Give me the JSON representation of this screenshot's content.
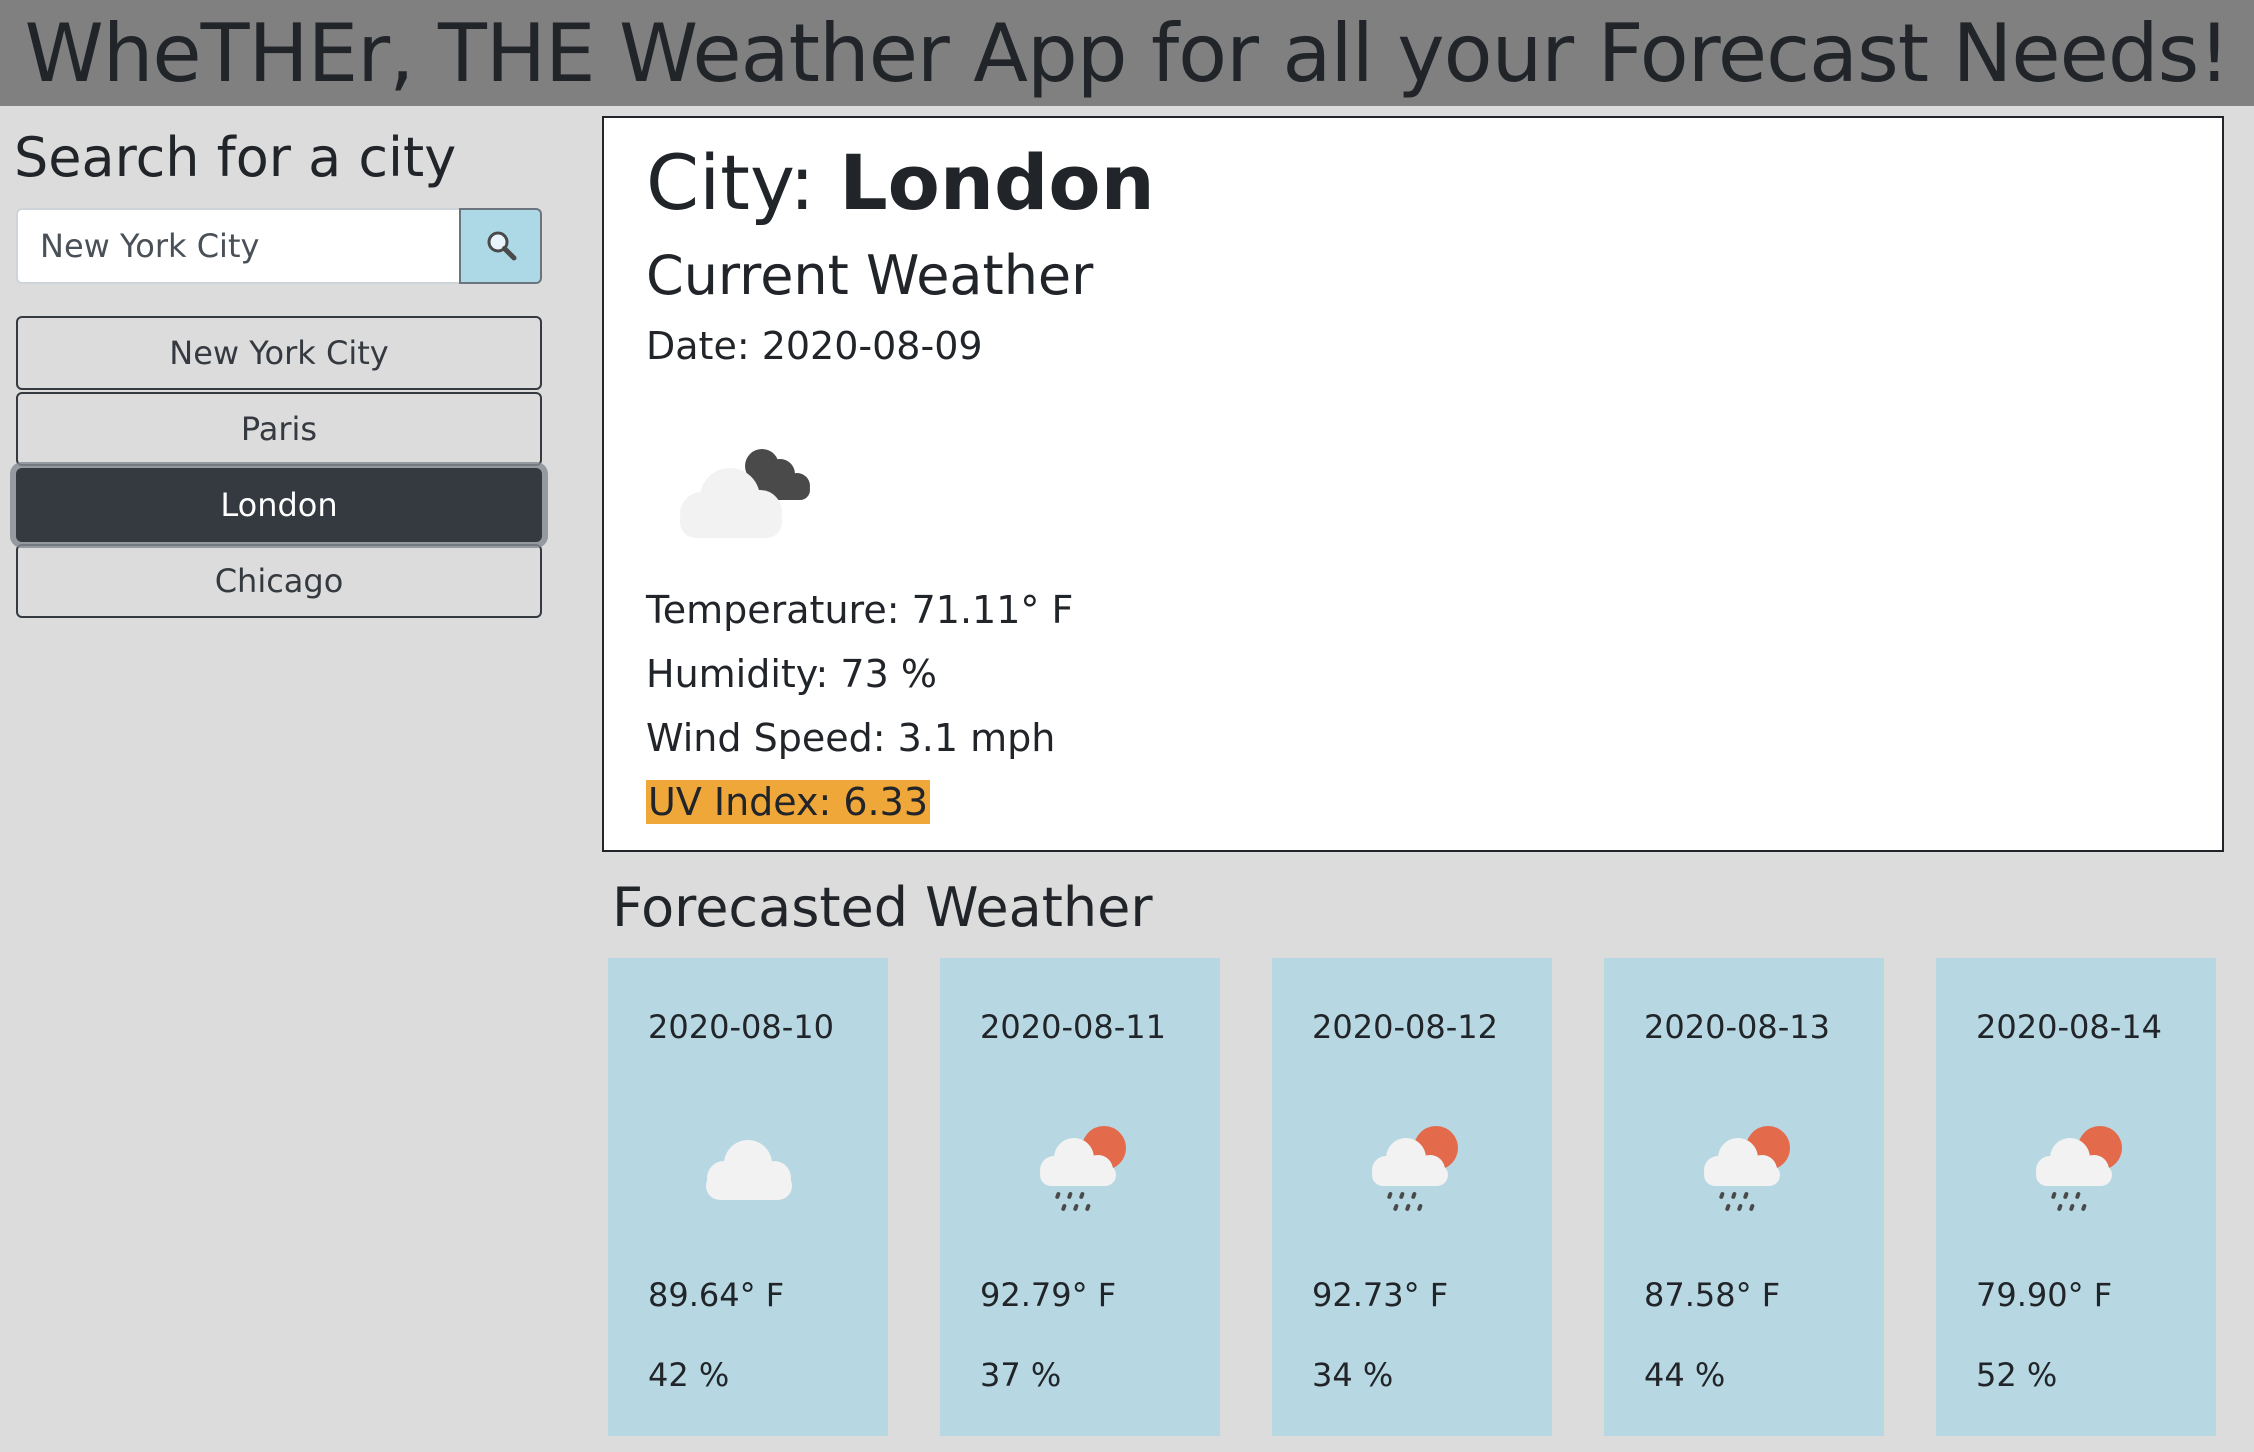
{
  "header": {
    "title": "WheTHEr, THE Weather App for all your Forecast Needs!"
  },
  "sidebar": {
    "title": "Search for a city",
    "search": {
      "value": "New York City"
    },
    "search_icon": "magnifying-glass",
    "cities": [
      {
        "label": "New York City",
        "active": false
      },
      {
        "label": "Paris",
        "active": false
      },
      {
        "label": "London",
        "active": true
      },
      {
        "label": "Chicago",
        "active": false
      }
    ]
  },
  "current": {
    "city_prefix": "City:",
    "city_name": "London",
    "title": "Current Weather",
    "date": "Date: 2020-08-09",
    "icon": "broken-clouds",
    "temperature": "Temperature: 71.11° F",
    "humidity": "Humidity: 73 %",
    "wind": "Wind Speed: 3.1 mph",
    "uv": "UV Index: 6.33",
    "uv_color": "#f0a73a"
  },
  "forecast": {
    "title": "Forecasted Weather",
    "card_color": "#b7d8e2",
    "days": [
      {
        "date": "2020-08-10",
        "icon": "cloud",
        "temp": "89.64° F",
        "humidity": "42 %"
      },
      {
        "date": "2020-08-11",
        "icon": "rain-sun",
        "temp": "92.79° F",
        "humidity": "37 %"
      },
      {
        "date": "2020-08-12",
        "icon": "rain-sun",
        "temp": "92.73° F",
        "humidity": "34 %"
      },
      {
        "date": "2020-08-13",
        "icon": "rain-sun",
        "temp": "87.58° F",
        "humidity": "44 %"
      },
      {
        "date": "2020-08-14",
        "icon": "rain-sun",
        "temp": "79.90° F",
        "humidity": "52 %"
      }
    ]
  }
}
